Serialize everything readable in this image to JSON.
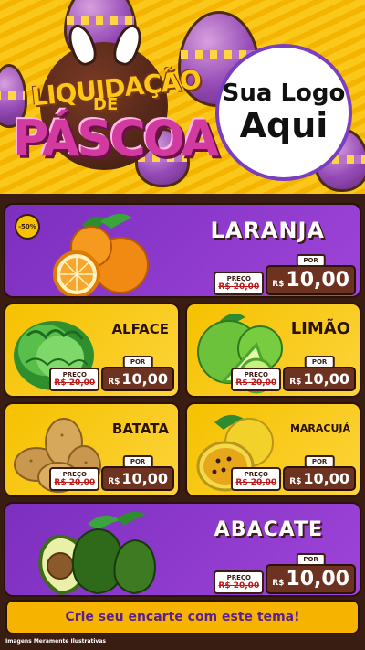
{
  "header": {
    "title_line1": "LIQUIDAÇÃO",
    "title_line2": "DE",
    "title_line3": "PÁSCOA",
    "logo_line1": "Sua Logo",
    "logo_line2": "Aqui"
  },
  "products": [
    {
      "name": "LARANJA",
      "badge": "-50%",
      "old_label": "PREÇO",
      "old_price": "R$ 20,00",
      "por_label": "POR",
      "currency": "R$",
      "price": "10,00",
      "icon": "orange-icon"
    },
    {
      "name": "ALFACE",
      "old_label": "PREÇO",
      "old_price": "R$ 20,00",
      "por_label": "POR",
      "currency": "R$",
      "price": "10,00",
      "icon": "lettuce-icon"
    },
    {
      "name": "LIMÃO",
      "old_label": "PREÇO",
      "old_price": "R$ 20,00",
      "por_label": "POR",
      "currency": "R$",
      "price": "10,00",
      "icon": "lime-icon"
    },
    {
      "name": "BATATA",
      "old_label": "PREÇO",
      "old_price": "R$ 20,00",
      "por_label": "POR",
      "currency": "R$",
      "price": "10,00",
      "icon": "potato-icon"
    },
    {
      "name": "MARACUJÁ",
      "old_label": "PREÇO",
      "old_price": "R$ 20,00",
      "por_label": "POR",
      "currency": "R$",
      "price": "10,00",
      "icon": "passionfruit-icon"
    },
    {
      "name": "ABACATE",
      "old_label": "PREÇO",
      "old_price": "R$ 20,00",
      "por_label": "POR",
      "currency": "R$",
      "price": "10,00",
      "icon": "avocado-icon"
    }
  ],
  "footer": {
    "cta": "Crie seu encarte com este tema!",
    "disclaimer": "Imagens Meramente Ilustrativas"
  },
  "colors": {
    "purple": "#8b3ec8",
    "yellow": "#f6c100",
    "brown": "#3a1d12",
    "red_price": "#c01818"
  }
}
